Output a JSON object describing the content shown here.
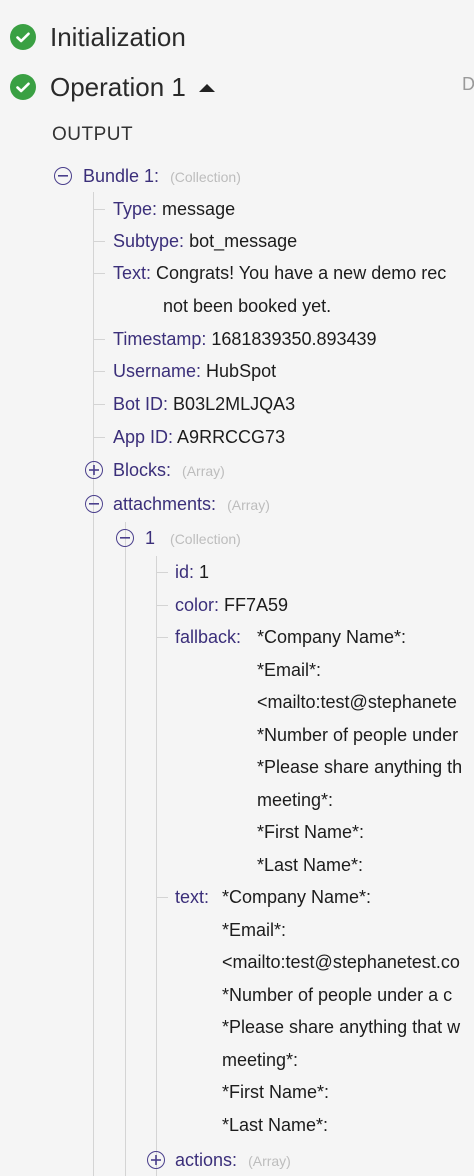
{
  "steps": [
    {
      "title": "Initialization"
    },
    {
      "title": "Operation 1"
    }
  ],
  "right_edge_glyph": "D",
  "output_label": "OUTPUT",
  "bundle": {
    "label": "Bundle 1:",
    "type": "(Collection)",
    "fields": {
      "type_key": "Type:",
      "type_val": "message",
      "subtype_key": "Subtype:",
      "subtype_val": "bot_message",
      "text_key": "Text:",
      "text_line1": "Congrats! You have a new demo rec",
      "text_line2": "not been booked yet.",
      "timestamp_key": "Timestamp:",
      "timestamp_val": "1681839350.893439",
      "username_key": "Username:",
      "username_val": "HubSpot",
      "botid_key": "Bot ID:",
      "botid_val": "B03L2MLJQA3",
      "appid_key": "App ID:",
      "appid_val": "A9RRCCG73"
    },
    "blocks": {
      "label": "Blocks:",
      "type": "(Array)"
    },
    "attachments": {
      "label": "attachments:",
      "type": "(Array)",
      "item": {
        "label": "1",
        "type": "(Collection)",
        "id_key": "id:",
        "id_val": "1",
        "color_key": "color:",
        "color_val": "FF7A59",
        "fallback_key": "fallback:",
        "fallback_lines": [
          "*Company Name*:",
          "*Email*:",
          "<mailto:test@stephanete",
          "*Number of people under",
          "*Please share anything th",
          "meeting*:",
          "*First Name*:",
          "*Last Name*:"
        ],
        "text_key": "text:",
        "text_lines": [
          "*Company Name*:",
          "*Email*:",
          "<mailto:test@stephanetest.co",
          "*Number of people under a c",
          "*Please share anything that w",
          "meeting*:",
          "*First Name*:",
          "*Last Name*:"
        ],
        "actions": {
          "label": "actions:",
          "type": "(Array)"
        }
      }
    }
  },
  "colors": {
    "check": "#3aa043",
    "key": "#3b2f7a",
    "type_hint": "#bdbdbd"
  }
}
